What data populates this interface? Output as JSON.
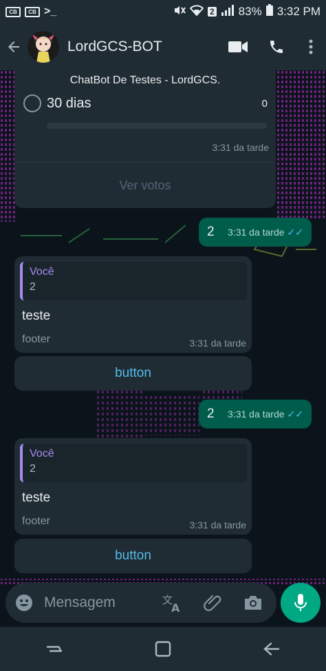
{
  "status_bar": {
    "battery": "83%",
    "time": "3:32 PM",
    "badge": "2",
    "left_icons": [
      "CB",
      "CB"
    ]
  },
  "header": {
    "title": "LordGCS-BOT"
  },
  "poll": {
    "caption": "ChatBot De Testes - LordGCS.",
    "option_label": "30 dias",
    "option_votes": "0",
    "time": "3:31 da tarde",
    "view_votes": "Ver votos"
  },
  "messages": [
    {
      "type": "outgoing",
      "text": "2",
      "time": "3:31 da tarde"
    },
    {
      "type": "incoming",
      "quote_name": "Você",
      "quote_text": "2",
      "text": "teste",
      "footer": "footer",
      "time": "3:31 da tarde",
      "button": "button"
    },
    {
      "type": "outgoing",
      "text": "2",
      "time": "3:31 da tarde"
    },
    {
      "type": "incoming",
      "quote_name": "Você",
      "quote_text": "2",
      "text": "teste",
      "footer": "footer",
      "time": "3:31 da tarde",
      "button": "button"
    }
  ],
  "input": {
    "placeholder": "Mensagem"
  },
  "colors": {
    "accent": "#00a884",
    "outgoing_bubble": "#005c4b",
    "incoming_bubble": "#202c33",
    "header": "#1f2c34",
    "link": "#53bdeb",
    "quote_name": "#a68bf0"
  }
}
